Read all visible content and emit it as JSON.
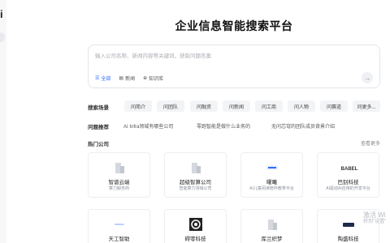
{
  "app": {
    "logo_fragment": "i",
    "title": "企业信息智能搜索平台"
  },
  "search": {
    "placeholder": "输入公司名称、新闻内容等关键词，获取问题答案",
    "modes": [
      {
        "label": "全部",
        "icon": "grid-icon",
        "active": true
      },
      {
        "label": "新闻",
        "icon": "news-icon",
        "active": false
      },
      {
        "label": "知识库",
        "icon": "globe-icon",
        "active": false
      }
    ],
    "send_icon": "arrow-right-icon"
  },
  "search_scenes": {
    "label": "搜索场景",
    "chips": [
      "问简介",
      "问团队",
      "问融资",
      "问新闻",
      "问工商",
      "问人物",
      "问赛道",
      "问更多..."
    ]
  },
  "recommendations": {
    "label": "问题推荐",
    "items": [
      "AI Infra领域有哪些公司",
      "零跑智能是做什么业务的",
      "无问芯穹的团队成员背景介绍"
    ]
  },
  "hot_companies": {
    "title": "热门公司",
    "view_more": "查看更多",
    "cards": [
      {
        "name": "智谱云端",
        "desc": "算力服务商",
        "logo": "building-icon"
      },
      {
        "name": "超级智算公司",
        "desc": "智能算力领域公司",
        "logo": "building-icon"
      },
      {
        "name": "曜曦",
        "desc": "AI儿童阅读陪伴教育平台",
        "logo": "brand-logo-blue",
        "brand_color": "#2f6bff"
      },
      {
        "name": "巴别科技",
        "desc": "AI驱动AI应用的开发平台",
        "logo": "brand-logo-text",
        "logo_text": "BABEL"
      },
      {
        "name": "天工智助",
        "desc": "",
        "logo": "brand-logo-small-text"
      },
      {
        "name": "碍零科技",
        "desc": "",
        "logo": "brand-logo-circle"
      },
      {
        "name": "库兰织梦",
        "desc": "",
        "logo": "building-icon"
      },
      {
        "name": "陶盛科技",
        "desc": "",
        "logo": "brand-logo-dark"
      }
    ]
  },
  "watermark": {
    "line1": "激活 Wi",
    "line2": "转到\"设置\""
  }
}
